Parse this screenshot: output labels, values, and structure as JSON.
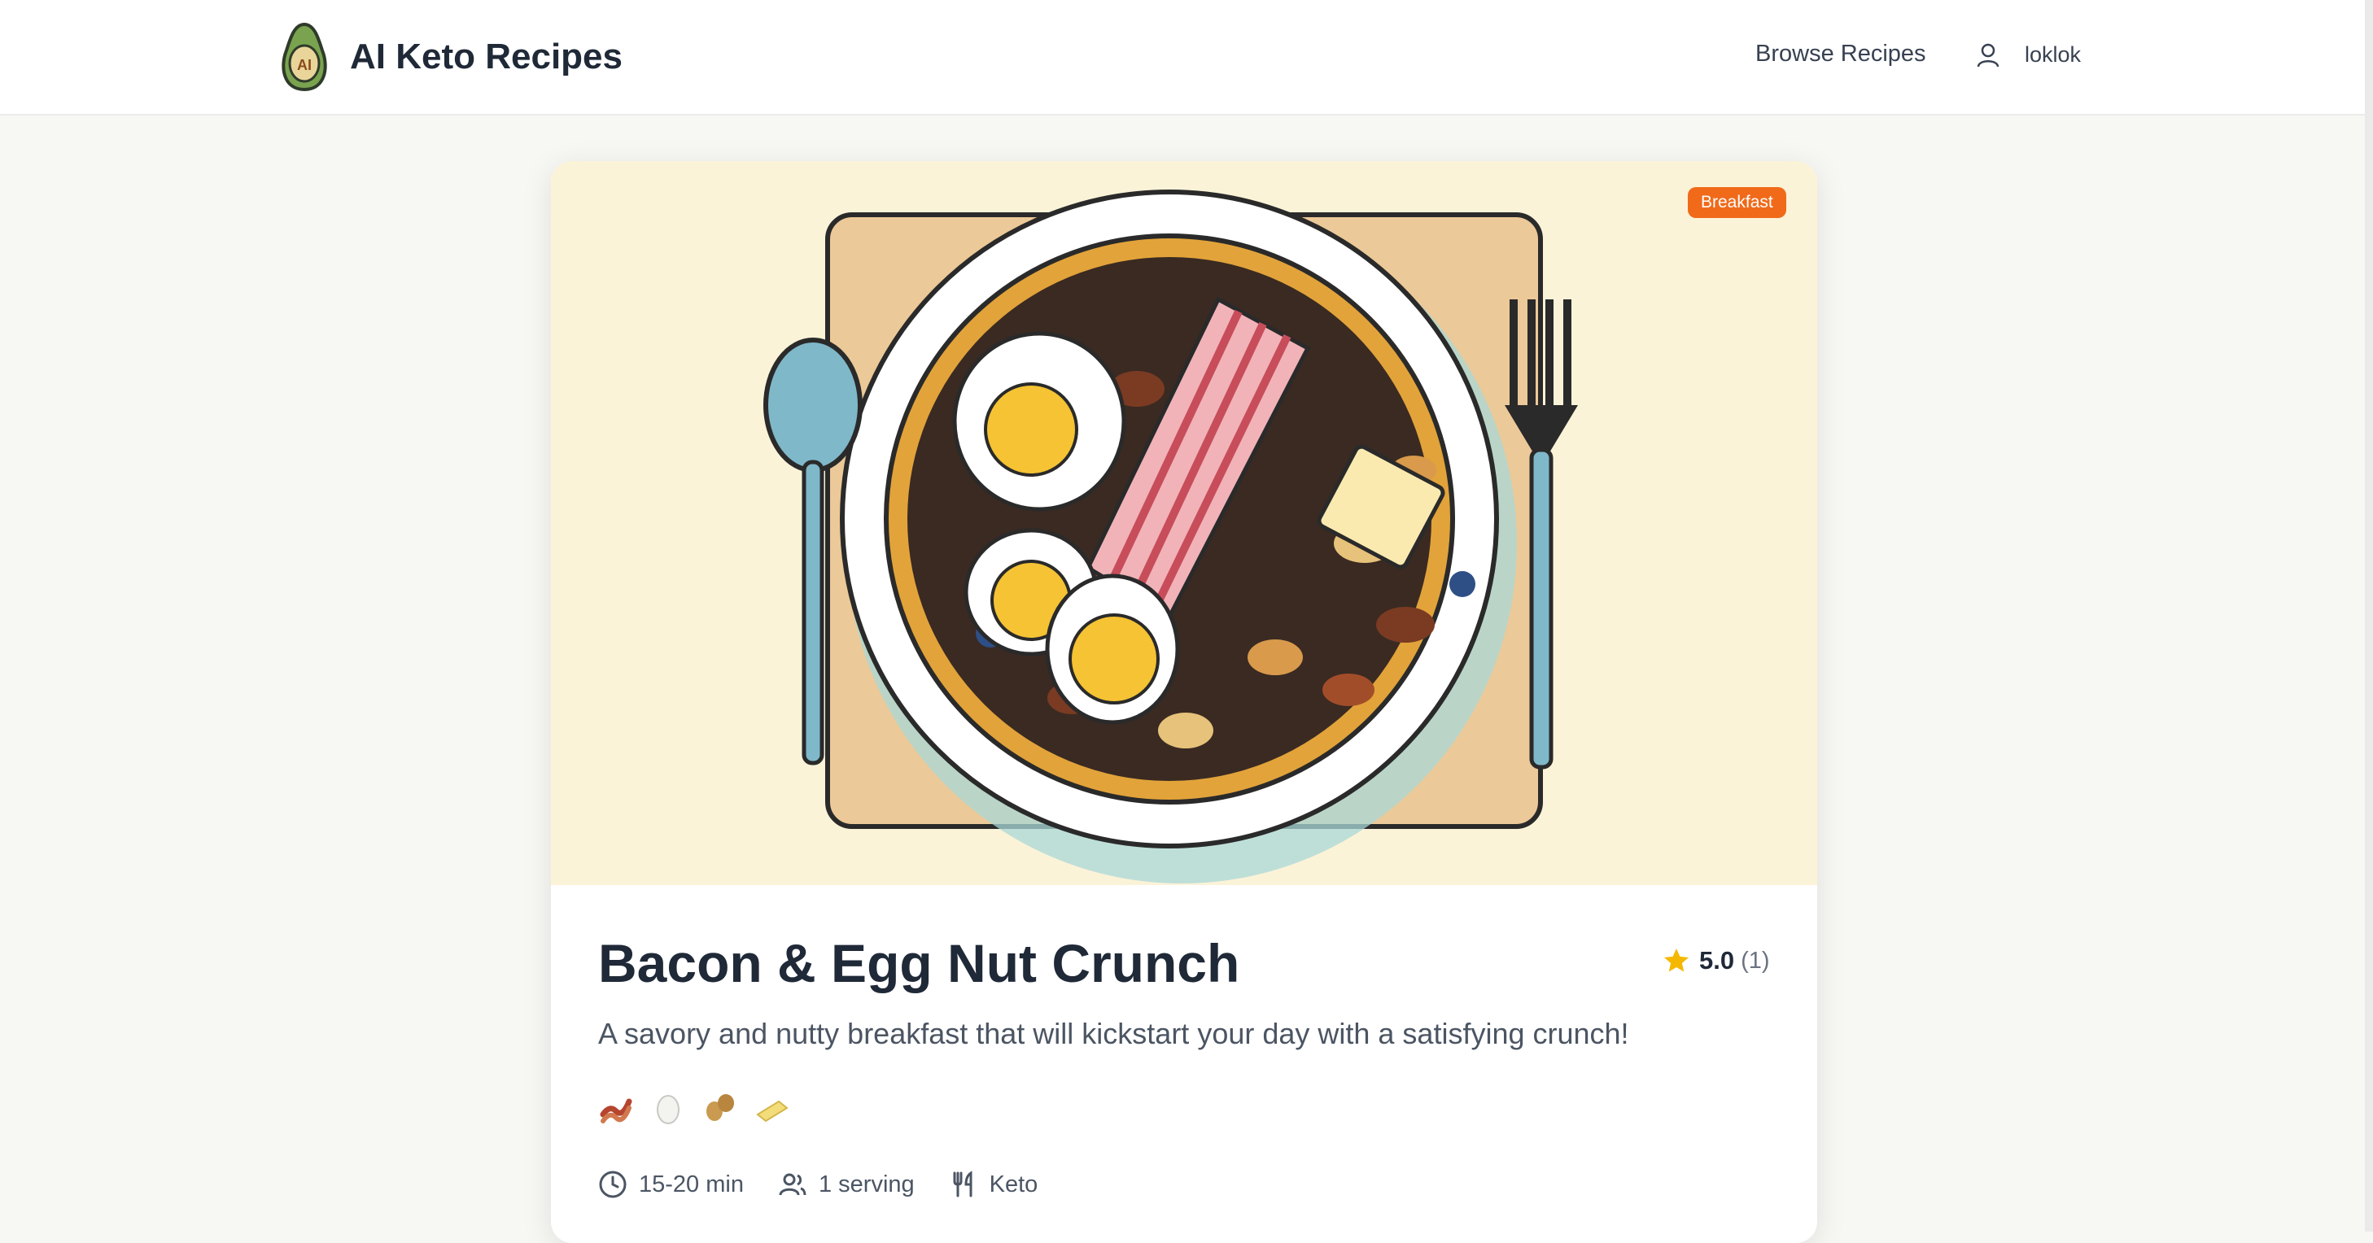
{
  "header": {
    "brand": "AI Keto Recipes",
    "logo_mark": "AI",
    "nav_browse": "Browse Recipes",
    "user": "loklok"
  },
  "recipe": {
    "category_badge": "Breakfast",
    "title": "Bacon & Egg Nut Crunch",
    "rating": "5.0",
    "rating_count": "(1)",
    "description": "A savory and nutty breakfast that will kickstart your day with a satisfying crunch!",
    "ingredient_icons": [
      "bacon-icon",
      "egg-icon",
      "peanut-icon",
      "butter-icon"
    ],
    "time": "15-20 min",
    "servings": "1 serving",
    "diet": "Keto"
  },
  "colors": {
    "accent_badge": "#f06a1a",
    "hero_background": "#fbf3d8",
    "star": "#f5b800",
    "avocado_green": "#6fa35a"
  }
}
